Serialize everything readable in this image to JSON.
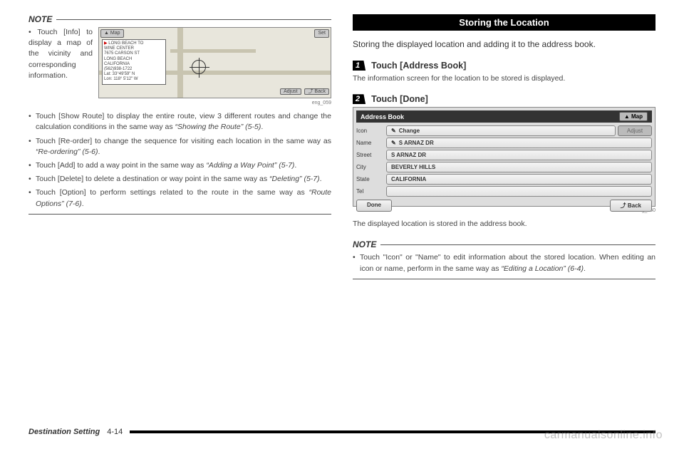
{
  "left": {
    "noteLabel": "NOTE",
    "bullets": [
      {
        "text": "Touch [Info] to display a map of the vicinity and corresponding information."
      },
      {
        "text": "Touch [Show Route] to display the entire route, view 3 different routes and change the calculation conditions in the same way as ",
        "em": "“Showing the Route” (5-5)",
        "tail": "."
      },
      {
        "text": "Touch [Re-order] to change the sequence for visiting each location in the same way as ",
        "em": "“Re-ordering” (5-6)",
        "tail": "."
      },
      {
        "text": "Touch [Add] to add a way point in the same way as ",
        "em": "“Adding a Way Point” (5-7)",
        "tail": "."
      },
      {
        "text": "Touch [Delete] to delete a destination or way point in the same way as ",
        "em": "“Deleting” (5-7)",
        "tail": "."
      },
      {
        "text": "Touch [Option] to perform settings related to the route in the same way as ",
        "em": "“Route Options” (7-6)",
        "tail": "."
      }
    ],
    "mapInfo": {
      "line1": "LONG BEACH TO",
      "line2": "WINE CENTER",
      "line3": "7675 CARSON ST",
      "line4": "LONG BEACH",
      "line5": "CALIFORNIA",
      "line6": "(562)938-1722",
      "line7": "Lat: 33°49'59\" N",
      "line8": "Lon: 118° 5'12\" W",
      "mapBtn": "▲ Map",
      "setBtn": "Set",
      "adjustBtn": "Adjust",
      "backBtn": "⤴ Back"
    },
    "img1Caption": "eng_059"
  },
  "right": {
    "title": "Storing the Location",
    "intro": "Storing the displayed location and adding it to the address book.",
    "step1Num": "1",
    "step1Text": "Touch [Address Book]",
    "step1Note": "The information screen for the location to be stored is displayed.",
    "step2Num": "2",
    "step2Text": "Touch [Done]",
    "addrBook": {
      "title": "Address Book",
      "mapBtn": "▲ Map",
      "rows": {
        "iconLabel": "Icon",
        "iconValue": "Change",
        "nameLabel": "Name",
        "nameValue": "S ARNAZ DR",
        "streetLabel": "Street",
        "streetValue": "S ARNAZ DR",
        "cityLabel": "City",
        "cityValue": "BEVERLY HILLS",
        "stateLabel": "State",
        "stateValue": "CALIFORNIA",
        "telLabel": "Tel",
        "telValue": ""
      },
      "adjust": "Adjust",
      "done": "Done",
      "back": "⤴ Back"
    },
    "img2Caption": "eng_060",
    "afterImg": "The displayed location is stored in the address book.",
    "noteLabel": "NOTE",
    "noteBullet": {
      "text": "Touch \"Icon\" or \"Name\" to edit information about the stored location. When editing an icon or name, perform in the same way as ",
      "em": "“Editing a Location” (6-4)",
      "tail": "."
    }
  },
  "footer": {
    "section": "Destination Setting",
    "page": "4-14"
  },
  "watermark": "carmanualsonline.info"
}
